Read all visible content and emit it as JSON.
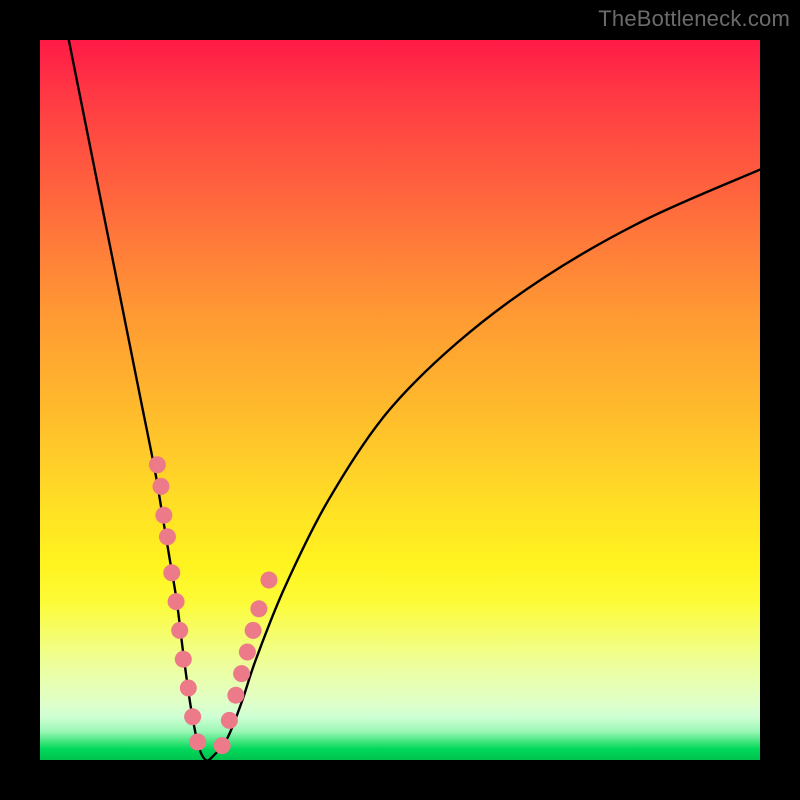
{
  "watermark": "TheBottleneck.com",
  "gradient": {
    "top": "#ff1a46",
    "mid": "#ffcc29",
    "bottom": "#00c24f"
  },
  "chart_data": {
    "type": "line",
    "title": "",
    "xlabel": "",
    "ylabel": "",
    "xlim": [
      0,
      100
    ],
    "ylim": [
      0,
      100
    ],
    "series": [
      {
        "name": "bottleneck-curve",
        "x": [
          4,
          6,
          8,
          10,
          12,
          14,
          16,
          17,
          18,
          19,
          20,
          21,
          22,
          23,
          24,
          26,
          28,
          30,
          34,
          40,
          48,
          58,
          70,
          84,
          100
        ],
        "y": [
          100,
          90,
          80,
          70,
          60,
          50,
          40,
          34,
          28,
          22,
          14,
          7,
          2,
          0,
          0.5,
          3,
          8,
          14,
          24,
          36,
          48,
          58,
          67,
          75,
          82
        ]
      }
    ],
    "markers": [
      {
        "name": "pink-dots",
        "color": "#ec7a88",
        "points": [
          {
            "x": 16.3,
            "y": 41
          },
          {
            "x": 16.8,
            "y": 38
          },
          {
            "x": 17.2,
            "y": 34
          },
          {
            "x": 17.7,
            "y": 31
          },
          {
            "x": 18.3,
            "y": 26
          },
          {
            "x": 18.9,
            "y": 22
          },
          {
            "x": 19.4,
            "y": 18
          },
          {
            "x": 19.9,
            "y": 14
          },
          {
            "x": 20.6,
            "y": 10
          },
          {
            "x": 21.2,
            "y": 6
          },
          {
            "x": 21.9,
            "y": 2.5
          },
          {
            "x": 25.3,
            "y": 2.0
          },
          {
            "x": 26.3,
            "y": 5.5
          },
          {
            "x": 27.2,
            "y": 9
          },
          {
            "x": 28.0,
            "y": 12
          },
          {
            "x": 28.8,
            "y": 15
          },
          {
            "x": 29.6,
            "y": 18
          },
          {
            "x": 30.4,
            "y": 21
          },
          {
            "x": 31.8,
            "y": 25
          }
        ]
      }
    ]
  }
}
